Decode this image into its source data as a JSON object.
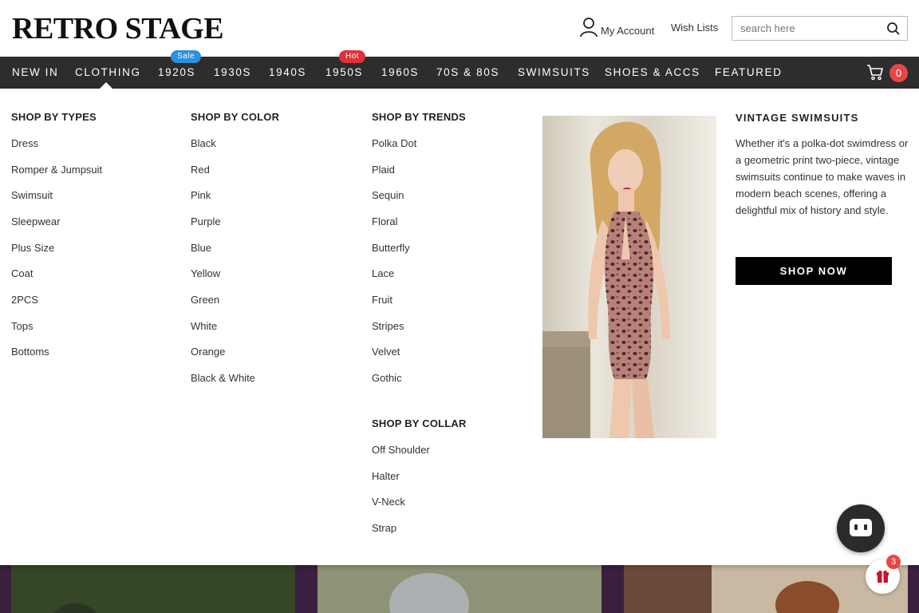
{
  "header": {
    "logo": "RETRO STAGE",
    "account_label": "My Account",
    "wishlists_label": "Wish Lists",
    "search_placeholder": "search here"
  },
  "nav": {
    "items": [
      {
        "label": "NEW IN"
      },
      {
        "label": "CLOTHING"
      },
      {
        "label": "1920S",
        "badge": "Sale"
      },
      {
        "label": "1930S"
      },
      {
        "label": "1940S"
      },
      {
        "label": "1950S",
        "badge": "Hot"
      },
      {
        "label": "1960S"
      },
      {
        "label": "70S & 80S"
      },
      {
        "label": "SWIMSUITS"
      },
      {
        "label": "SHOES & ACCS"
      },
      {
        "label": "FEATURED"
      }
    ],
    "cart_count": "0",
    "colors": {
      "bar": "#2d2d2d",
      "sale_badge": "#2f8fd8",
      "hot_badge": "#e0303a",
      "cart_badge": "#e84545"
    }
  },
  "menu": {
    "types": {
      "title": "SHOP BY TYPES",
      "items": [
        "Dress",
        "Romper & Jumpsuit",
        "Swimsuit",
        "Sleepwear",
        "Plus Size",
        "Coat",
        "2PCS",
        "Tops",
        "Bottoms"
      ]
    },
    "color": {
      "title": "SHOP BY COLOR",
      "items": [
        "Black",
        "Red",
        "Pink",
        "Purple",
        "Blue",
        "Yellow",
        "Green",
        "White",
        "Orange",
        "Black & White"
      ]
    },
    "trends": {
      "title": "SHOP BY TRENDS",
      "items": [
        "Polka Dot",
        "Plaid",
        "Sequin",
        "Floral",
        "Butterfly",
        "Lace",
        "Fruit",
        "Stripes",
        "Velvet",
        "Gothic"
      ]
    },
    "collar": {
      "title": "SHOP BY COLLAR",
      "items": [
        "Off Shoulder",
        "Halter",
        "V-Neck",
        "Strap"
      ]
    },
    "promo": {
      "title": "VINTAGE SWIMSUITS",
      "text": "Whether it's a polka-dot swimdress or a geometric print two-piece, vintage swimsuits continue to make waves in modern beach scenes, offering a delightful mix of history and style.",
      "button": "SHOP NOW"
    }
  },
  "widgets": {
    "gift_count": "3"
  }
}
